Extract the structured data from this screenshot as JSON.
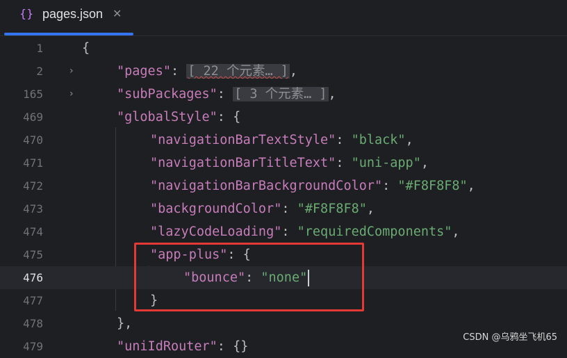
{
  "tab": {
    "icon": "{}",
    "title": "pages.json",
    "close": "✕"
  },
  "editor": {
    "lines": [
      {
        "num": "1",
        "text": "{"
      },
      {
        "num": "2",
        "key": "\"pages\"",
        "colon": ": ",
        "folded": "[ 22 个元素… ]",
        "tail": ","
      },
      {
        "num": "165",
        "key": "\"subPackages\"",
        "colon": ": ",
        "folded": "[ 3 个元素… ]",
        "tail": ","
      },
      {
        "num": "469",
        "key": "\"globalStyle\"",
        "colon": ": {"
      },
      {
        "num": "470",
        "key": "\"navigationBarTextStyle\"",
        "colon": ": ",
        "value": "\"black\"",
        "tail": ","
      },
      {
        "num": "471",
        "key": "\"navigationBarTitleText\"",
        "colon": ": ",
        "value": "\"uni-app\"",
        "tail": ","
      },
      {
        "num": "472",
        "key": "\"navigationBarBackgroundColor\"",
        "colon": ": ",
        "value": "\"#F8F8F8\"",
        "tail": ","
      },
      {
        "num": "473",
        "key": "\"backgroundColor\"",
        "colon": ": ",
        "value": "\"#F8F8F8\"",
        "tail": ","
      },
      {
        "num": "474",
        "key": "\"lazyCodeLoading\"",
        "colon": ": ",
        "value": "\"requiredComponents\"",
        "tail": ","
      },
      {
        "num": "475",
        "key": "\"app-plus\"",
        "colon": ": {"
      },
      {
        "num": "476",
        "key": "\"bounce\"",
        "colon": ": ",
        "value": "\"none\""
      },
      {
        "num": "477",
        "text": "}"
      },
      {
        "num": "478",
        "text": "},"
      },
      {
        "num": "479",
        "key": "\"uniIdRouter\"",
        "colon": ": {}"
      }
    ]
  },
  "watermark": "CSDN @乌鸦坐飞机65"
}
